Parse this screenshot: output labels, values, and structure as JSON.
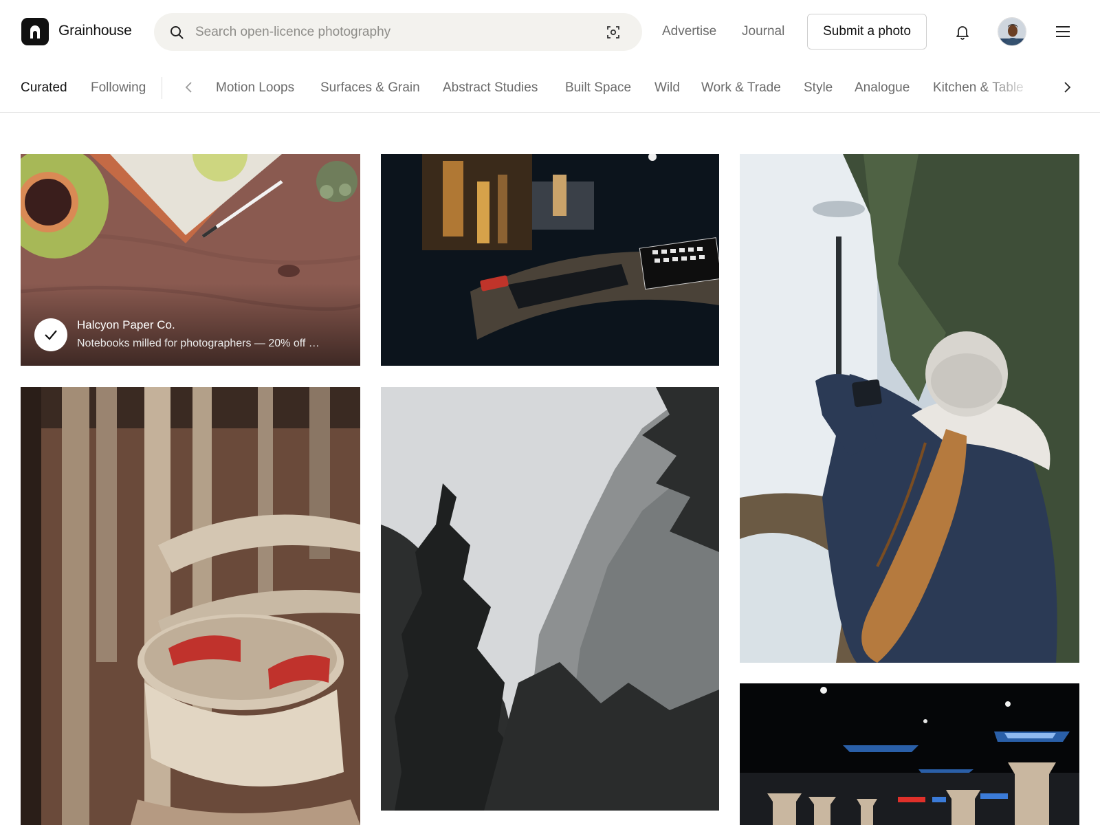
{
  "brand": {
    "name": "Grainhouse",
    "accent": "#111111"
  },
  "search": {
    "placeholder": "Search open-licence photography",
    "icon": "search-icon",
    "visual_search_icon": "visual-search-icon"
  },
  "nav": {
    "advertise": "Advertise",
    "journal": "Journal",
    "submit": "Submit a photo"
  },
  "tabs": {
    "primary": [
      "Curated",
      "Following"
    ],
    "active": "Curated",
    "topics": [
      "Motion Loops",
      "Surfaces & Grain",
      "Abstract Studies",
      "Built Space",
      "Wild",
      "Work & Trade",
      "Style",
      "Analogue",
      "Kitchen & Table"
    ]
  },
  "sponsored": {
    "name": "Halcyon Paper Co.",
    "tagline": "Notebooks milled for photographers — 20% off …"
  }
}
